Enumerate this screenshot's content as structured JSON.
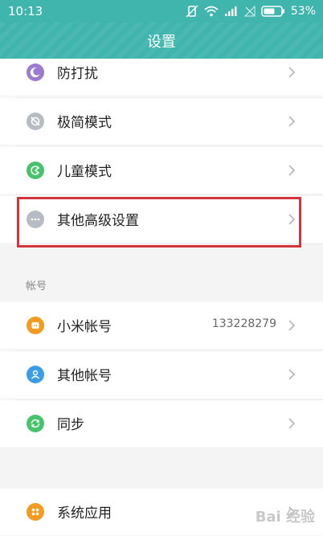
{
  "status": {
    "time": "10:13",
    "battery": "53%"
  },
  "header": {
    "title": "设置"
  },
  "rows": [
    {
      "label": "防打扰",
      "icon": "moon-icon",
      "color": "#9b7bd0"
    },
    {
      "label": "极简模式",
      "icon": "minimal-mode-icon",
      "color": "#b6bcc4"
    },
    {
      "label": "儿童模式",
      "icon": "child-mode-icon",
      "color": "#47c46b"
    },
    {
      "label": "其他高级设置",
      "icon": "more-icon",
      "color": "#b6bcc4"
    }
  ],
  "account_section": {
    "header": "帐号",
    "rows": [
      {
        "label": "小米帐号",
        "value": "133228279",
        "icon": "mi-account-icon",
        "color": "#f29a21"
      },
      {
        "label": "其他帐号",
        "icon": "user-icon",
        "color": "#3a9de6"
      },
      {
        "label": "同步",
        "icon": "sync-icon",
        "color": "#47c46b"
      }
    ]
  },
  "apps_section": {
    "rows": [
      {
        "label": "系统应用",
        "icon": "apps-icon",
        "color": "#f29a21"
      }
    ]
  },
  "watermark": "Bai 经验"
}
